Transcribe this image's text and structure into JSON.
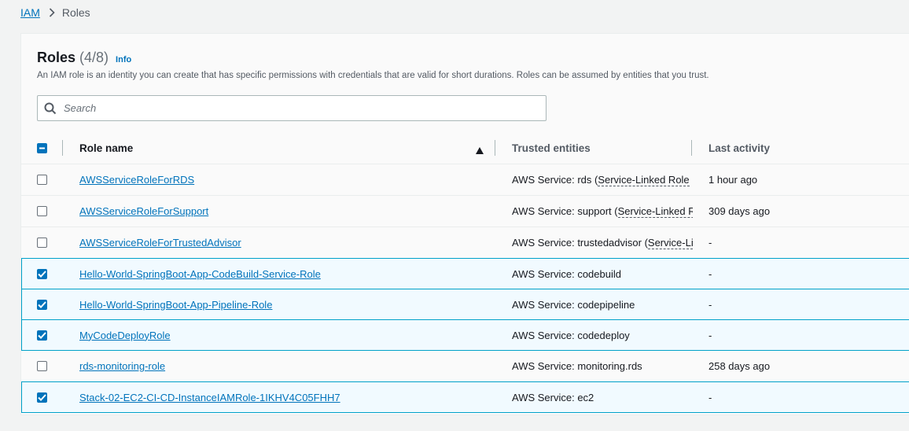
{
  "breadcrumb": {
    "root": "IAM",
    "separator_icon": "chevron-right-icon",
    "current": "Roles"
  },
  "header": {
    "title": "Roles",
    "count": "(4/8)",
    "info": "Info",
    "description": "An IAM role is an identity you can create that has specific permissions with credentials that are valid for short durations. Roles can be assumed by entities that you trust."
  },
  "search": {
    "placeholder": "Search",
    "value": "",
    "icon": "search-icon"
  },
  "table": {
    "select_all_state": "indeterminate",
    "columns": {
      "role_name": "Role name",
      "trusted_entities": "Trusted entities",
      "last_activity": "Last activity"
    },
    "sort": {
      "column": "Role name",
      "direction": "ascending"
    },
    "rows": [
      {
        "selected": false,
        "name": "AWSServiceRoleForRDS",
        "trusted_prefix": "AWS Service: rds (",
        "trusted_tag": "Service-Linked Role",
        "last_activity": "1 hour ago"
      },
      {
        "selected": false,
        "name": "AWSServiceRoleForSupport",
        "trusted_prefix": "AWS Service: support (",
        "trusted_tag": "Service-Linked Role",
        "last_activity": "309 days ago"
      },
      {
        "selected": false,
        "name": "AWSServiceRoleForTrustedAdvisor",
        "trusted_prefix": "AWS Service: trustedadvisor (",
        "trusted_tag": "Service-Linked Role",
        "last_activity": "-"
      },
      {
        "selected": true,
        "name": "Hello-World-SpringBoot-App-CodeBuild-Service-Role",
        "trusted_prefix": "AWS Service: codebuild",
        "trusted_tag": "",
        "last_activity": "-"
      },
      {
        "selected": true,
        "name": "Hello-World-SpringBoot-App-Pipeline-Role",
        "trusted_prefix": "AWS Service: codepipeline",
        "trusted_tag": "",
        "last_activity": "-"
      },
      {
        "selected": true,
        "name": "MyCodeDeployRole",
        "trusted_prefix": "AWS Service: codedeploy",
        "trusted_tag": "",
        "last_activity": "-"
      },
      {
        "selected": false,
        "name": "rds-monitoring-role",
        "trusted_prefix": "AWS Service: monitoring.rds",
        "trusted_tag": "",
        "last_activity": "258 days ago"
      },
      {
        "selected": true,
        "name": "Stack-02-EC2-CI-CD-InstanceIAMRole-1IKHV4C05FHH7",
        "trusted_prefix": "AWS Service: ec2",
        "trusted_tag": "",
        "last_activity": "-"
      }
    ]
  },
  "colors": {
    "link": "#0073bb",
    "selected_row_bg": "#f1faff",
    "selected_row_border": "#00a1c9",
    "page_bg": "#f2f3f3"
  }
}
